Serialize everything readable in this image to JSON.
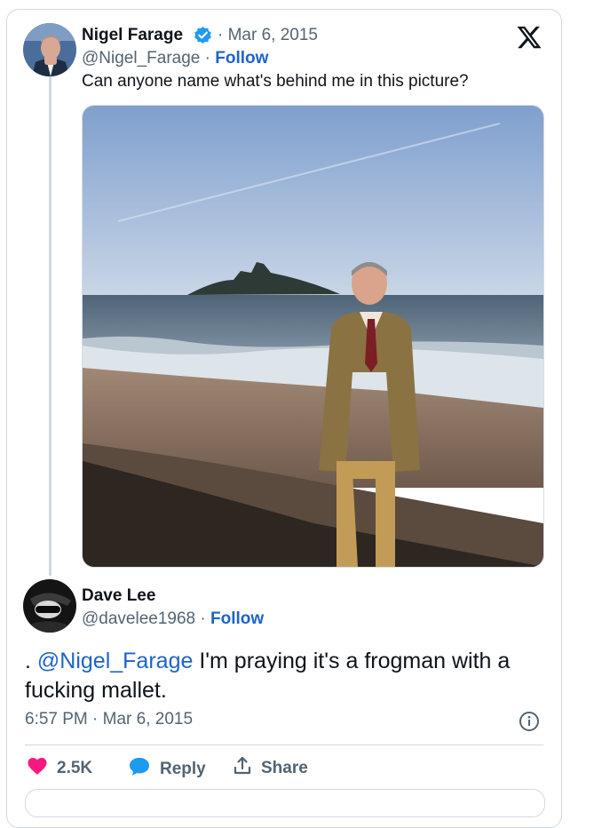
{
  "tweet": {
    "author_name": "Nigel Farage",
    "date": "· Mar 6, 2015",
    "handle": "@Nigel_Farage",
    "separator": "·",
    "follow_label": "Follow",
    "text": "Can anyone name what's behind me in this picture?"
  },
  "reply": {
    "author_name": "Dave Lee",
    "handle": "@davelee1968",
    "separator": "·",
    "follow_label": "Follow",
    "text_prefix": ". ",
    "mention": "@Nigel_Farage",
    "text_rest": " I'm praying it's a frogman with a fucking mallet.",
    "timestamp": "6:57 PM · Mar 6, 2015"
  },
  "actions": {
    "likes": "2.5K",
    "reply_label": "Reply",
    "share_label": "Share"
  },
  "icons": {
    "verified": "verified-badge-icon",
    "x_logo": "x-logo-icon",
    "info": "info-icon",
    "heart": "heart-icon",
    "reply": "reply-bubble-icon",
    "share": "share-icon"
  },
  "colors": {
    "link": "#1d64c8",
    "muted": "#536471",
    "like": "#f91880",
    "verified": "#1d9bf0"
  }
}
